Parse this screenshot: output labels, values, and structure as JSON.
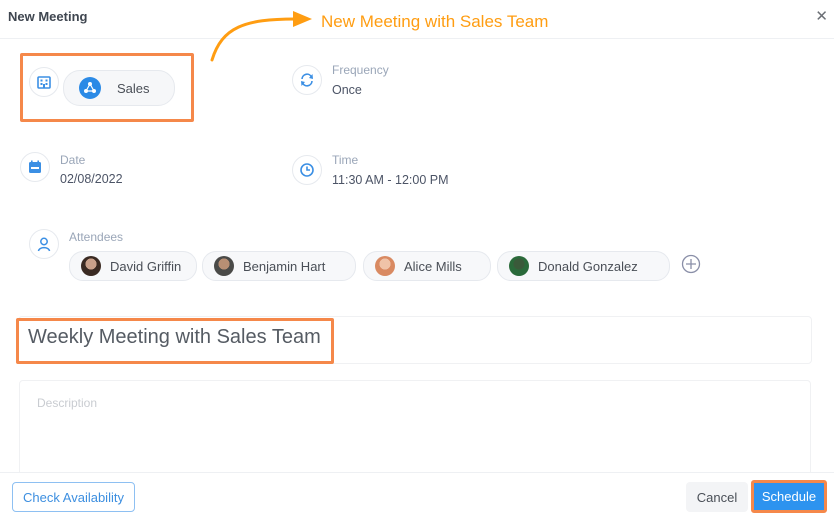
{
  "dialog": {
    "title": "New Meeting",
    "close_icon": "close-icon"
  },
  "annotation": {
    "text": "New Meeting with Sales Team",
    "color": "#ff9d12",
    "highlight_color": "#f5884a"
  },
  "team": {
    "icon": "building-icon",
    "chip_icon": "team-logo-icon",
    "label": "Sales"
  },
  "frequency": {
    "icon": "repeat-icon",
    "label": "Frequency",
    "value": "Once"
  },
  "date": {
    "icon": "calendar-icon",
    "label": "Date",
    "value": "02/08/2022"
  },
  "time": {
    "icon": "clock-icon",
    "label": "Time",
    "value": "11:30 AM - 12:00 PM"
  },
  "attendees": {
    "icon": "user-icon",
    "label": "Attendees",
    "people": [
      {
        "name": "David Griffin"
      },
      {
        "name": "Benjamin Hart"
      },
      {
        "name": "Alice Mills"
      },
      {
        "name": "Donald Gonzalez"
      }
    ],
    "add_icon": "add-circle-icon"
  },
  "meeting_title": {
    "value": "Weekly Meeting with Sales Team"
  },
  "description": {
    "placeholder": "Description",
    "value": ""
  },
  "footer": {
    "check_availability": "Check Availability",
    "cancel": "Cancel",
    "schedule": "Schedule"
  },
  "colors": {
    "primary": "#2d93ef",
    "label": "#9aa6b8"
  }
}
